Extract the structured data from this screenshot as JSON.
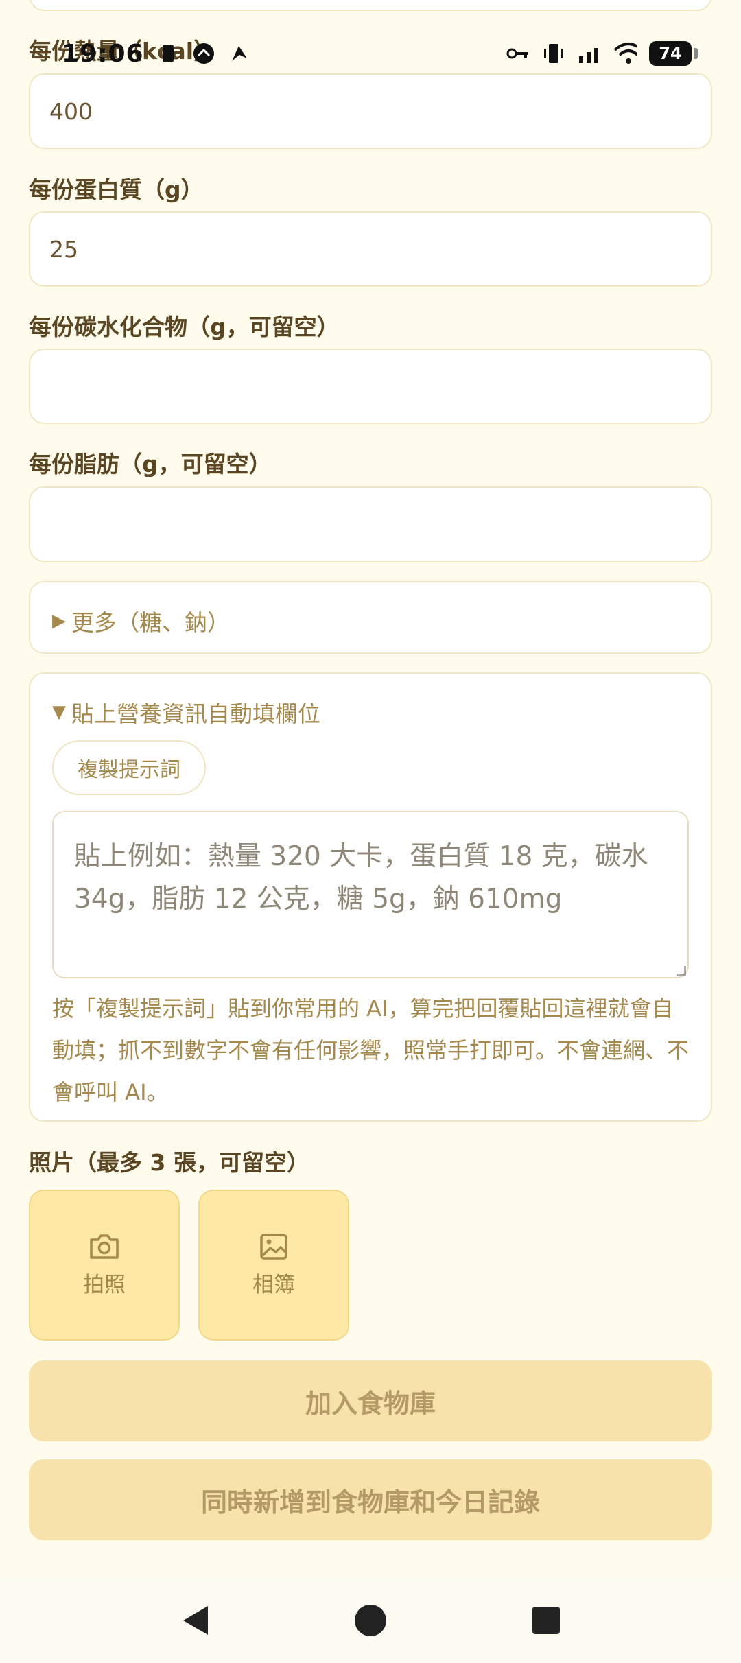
{
  "status_bar": {
    "time": "19:06",
    "battery": "74",
    "icons": [
      "notification-square-icon",
      "circle-app-icon",
      "navigation-icon",
      "vpn-key-icon",
      "vibrate-icon",
      "signal-icon",
      "wifi-icon",
      "battery-icon"
    ]
  },
  "form": {
    "calories_label": "每份熱量（kcal）",
    "calories_value": "400",
    "protein_label": "每份蛋白質（g）",
    "protein_value": "25",
    "carbs_label": "每份碳水化合物（g，可留空）",
    "carbs_value": "",
    "fat_label": "每份脂肪（g，可留空）",
    "fat_value": ""
  },
  "more_expander": {
    "arrow": "▶",
    "label": "更多（糖、鈉）"
  },
  "paste_expander": {
    "arrow": "▼",
    "label": "貼上營養資訊自動填欄位",
    "copy_button": "複製提示詞",
    "placeholder": "貼上例如：熱量 320 大卡，蛋白質 18 克，碳水 34g，脂肪 12 公克，糖 5g，鈉 610mg",
    "help": "按「複製提示詞」貼到你常用的 AI，算完把回覆貼回這裡就會自動填；抓不到數字不會有任何影響，照常手打即可。不會連網、不會呼叫 AI。"
  },
  "photos": {
    "label": "照片（最多 3 張，可留空）",
    "camera_label": "拍照",
    "album_label": "相簿"
  },
  "actions": {
    "add_to_library": "加入食物庫",
    "add_both": "同時新增到食物庫和今日記錄"
  },
  "colors": {
    "background": "#FFFCEE",
    "accent_light": "#FDE8A6",
    "button_disabled": "#F6E2AA",
    "muted_text": "#A5894C"
  }
}
